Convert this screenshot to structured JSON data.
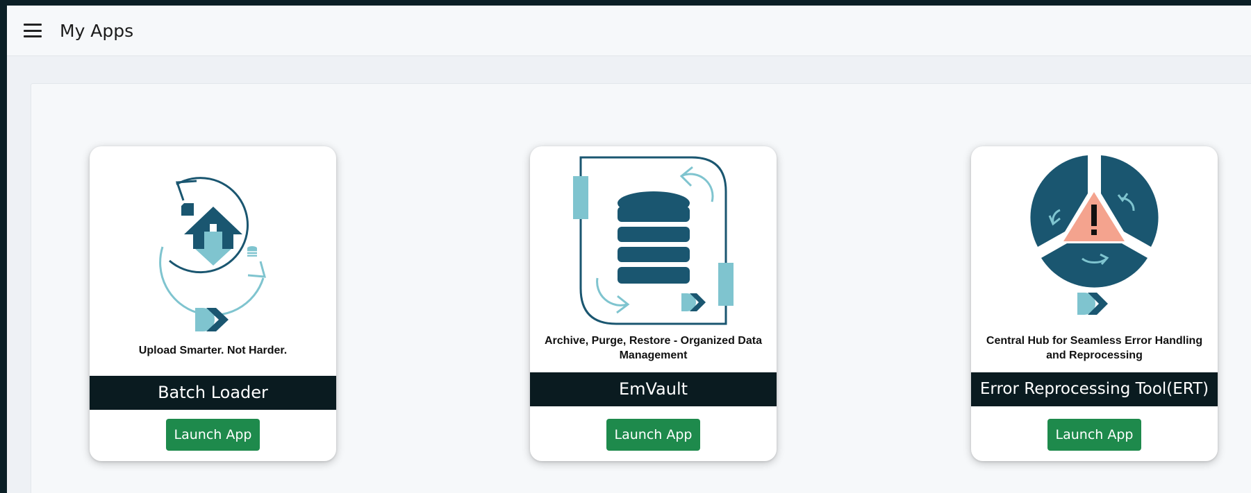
{
  "header": {
    "title": "My Apps"
  },
  "apps": [
    {
      "tagline": "Upload Smarter. Not Harder.",
      "name": "Batch Loader",
      "button": "Launch App"
    },
    {
      "tagline": "Archive, Purge, Restore - Organized Data Management",
      "name": "EmVault",
      "button": "Launch App"
    },
    {
      "tagline": "Central Hub for Seamless Error Handling and Reprocessing",
      "name": "Error Reprocessing Tool(ERT)",
      "button": "Launch App"
    }
  ],
  "colors": {
    "primary_dark": "#1a5670",
    "accent_light": "#7fc4cf",
    "warning": "#f4a38e",
    "button_green": "#1e8a4c",
    "name_bar": "#0a1b20"
  },
  "icons": [
    "menu-icon",
    "cloud-upload-icon",
    "database-icon",
    "error-alert-icon",
    "brand-logo-icon"
  ]
}
